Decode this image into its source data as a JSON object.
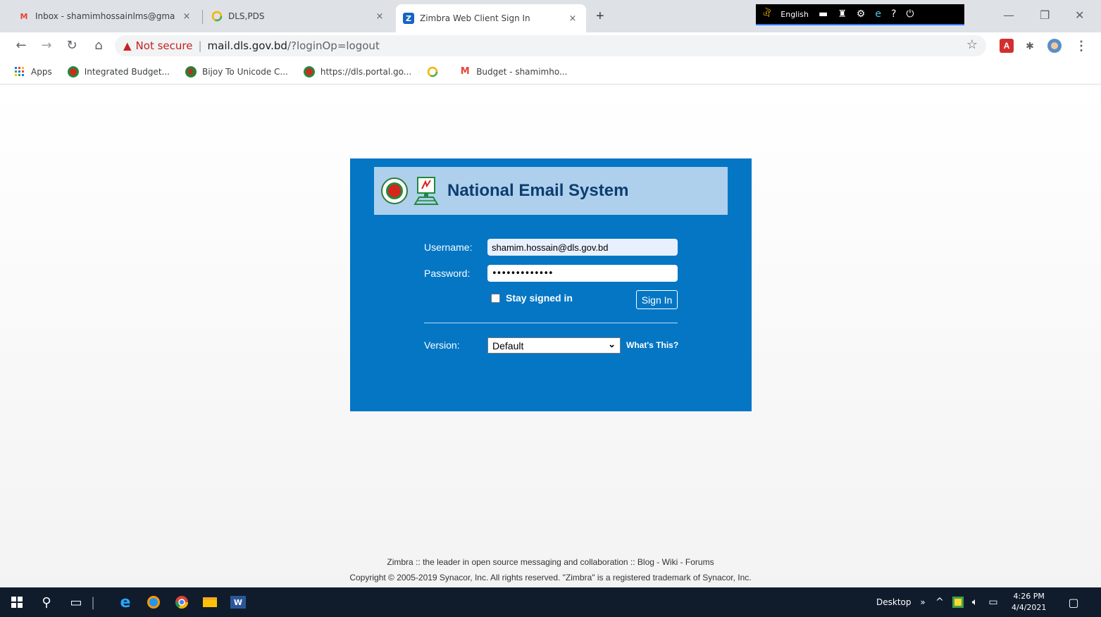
{
  "browser": {
    "tabs": [
      {
        "title": "Inbox - shamimhossainlms@gma",
        "icon": "gmail-icon"
      },
      {
        "title": "DLS,PDS",
        "icon": "ring-logo-icon"
      },
      {
        "title": "Zimbra Web Client Sign In",
        "icon": "zimbra-icon",
        "active": true
      }
    ],
    "new_tab": "+",
    "close_glyph": "×",
    "ime": {
      "language": "English"
    },
    "address": {
      "warning": "Not secure",
      "host": "mail.dls.gov.bd",
      "path": "/?loginOp=logout"
    },
    "bookmarks": [
      {
        "label": "Apps",
        "icon": "apps-grid-icon"
      },
      {
        "label": "Integrated Budget...",
        "icon": "seal-icon"
      },
      {
        "label": "Bijoy To Unicode C...",
        "icon": "dot-icon"
      },
      {
        "label": "https://dls.portal.go...",
        "icon": "seal-icon"
      },
      {
        "label": "",
        "icon": "ring-logo-icon"
      },
      {
        "label": "Budget - shamimho...",
        "icon": "gmail-icon"
      }
    ]
  },
  "login": {
    "brand": "National Email System",
    "username_label": "Username:",
    "username_value": "shamim.hossain@dls.gov.bd",
    "password_label": "Password:",
    "password_value": "•••••••••••••",
    "stay_signed_in": "Stay signed in",
    "sign_in": "Sign In",
    "version_label": "Version:",
    "version_value": "Default",
    "whats_this": "What's This?"
  },
  "footer": {
    "line1": "Zimbra :: the leader in open source messaging and collaboration :: Blog - Wiki - Forums",
    "line2": "Copyright © 2005-2019 Synacor, Inc. All rights reserved. \"Zimbra\" is a registered trademark of Synacor, Inc."
  },
  "taskbar": {
    "desktop": "Desktop",
    "time": "4:26 PM",
    "date": "4/4/2021"
  },
  "colors": {
    "card": "#0476c4",
    "banner": "#aed0ec",
    "brand_text": "#0d3d70",
    "taskbar": "#101c2c"
  }
}
